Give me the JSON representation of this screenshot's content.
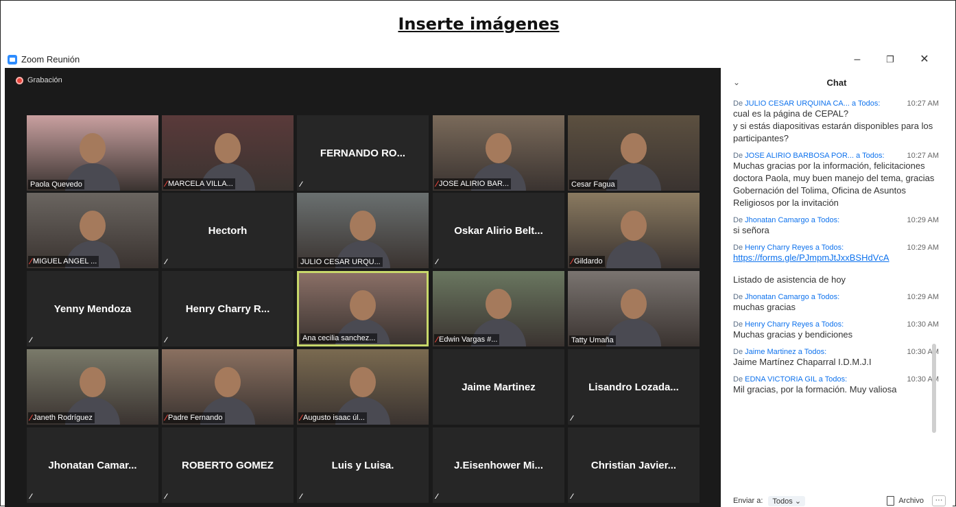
{
  "document": {
    "title": "Inserte imágenes"
  },
  "app": {
    "title": "Zoom Reunión",
    "minimize": "–",
    "restore": "❐",
    "close": "✕"
  },
  "recording": {
    "label": "Grabación"
  },
  "tiles": [
    {
      "label": "Paola Quevedo",
      "muted": false,
      "video": true,
      "bg": "#c9a0a0"
    },
    {
      "label": "MARCELA VILLA...",
      "muted": true,
      "video": true,
      "bg": "#5a3a3a"
    },
    {
      "label": "FERNANDO RO...",
      "muted": true,
      "video": false
    },
    {
      "label": "JOSE ALIRIO BAR...",
      "muted": true,
      "video": true,
      "bg": "#7a6a5a"
    },
    {
      "label": "Cesar Fagua",
      "muted": false,
      "video": true,
      "bg": "#5c5040"
    },
    {
      "label": "MIGUEL ANGEL ...",
      "muted": true,
      "video": true,
      "bg": "#6a6560"
    },
    {
      "label": "Hectorh",
      "muted": true,
      "video": false
    },
    {
      "label": "JULIO CESAR URQU...",
      "muted": false,
      "video": true,
      "bg": "#6a7070"
    },
    {
      "label": "Oskar Alirio Belt...",
      "muted": true,
      "video": false
    },
    {
      "label": "Gildardo",
      "muted": true,
      "video": true,
      "bg": "#8a7a60"
    },
    {
      "label": "Yenny Mendoza",
      "muted": true,
      "video": false
    },
    {
      "label": "Henry Charry R...",
      "muted": true,
      "video": false
    },
    {
      "label": "Ana cecilia sanchez...",
      "muted": false,
      "video": true,
      "active": true,
      "bg": "#8a6f66"
    },
    {
      "label": "Edwin Vargas #...",
      "muted": true,
      "video": true,
      "bg": "#6a7760"
    },
    {
      "label": "Tatty Umaña",
      "muted": false,
      "video": true,
      "bg": "#7a7470"
    },
    {
      "label": "Janeth Rodríguez",
      "muted": true,
      "video": true,
      "bg": "#7a7a6a"
    },
    {
      "label": "Padre Fernando",
      "muted": true,
      "video": true,
      "bg": "#8a7060"
    },
    {
      "label": "Augusto isaac úl...",
      "muted": true,
      "video": true,
      "bg": "#7a6a50"
    },
    {
      "label": "Jaime Martinez",
      "muted": false,
      "video": false
    },
    {
      "label": "Lisandro Lozada...",
      "muted": true,
      "video": false
    },
    {
      "label": "Jhonatan Camar...",
      "muted": true,
      "video": false
    },
    {
      "label": "ROBERTO GOMEZ",
      "muted": true,
      "video": false
    },
    {
      "label": "Luis y Luisa.",
      "muted": true,
      "video": false
    },
    {
      "label": "J.Eisenhower Mi...",
      "muted": true,
      "video": false
    },
    {
      "label": "Christian Javier...",
      "muted": true,
      "video": false
    }
  ],
  "chat": {
    "title": "Chat",
    "chevron": "⌄",
    "messages": [
      {
        "prefix": "De",
        "from": "JULIO CESAR URQUINA CA...",
        "to": "a Todos:",
        "time": "10:27 AM",
        "text": "cual es la página de CEPAL?\ny si estás diapositivas estarán disponibles para los participantes?"
      },
      {
        "prefix": "De",
        "from": "JOSE ALIRIO BARBOSA POR...",
        "to": "a Todos:",
        "time": "10:27 AM",
        "text": "Muchas gracias por la información, felicitaciones doctora Paola, muy buen manejo del tema, gracias Gobernación del Tolima, Oficina de Asuntos Religiosos por la invitación"
      },
      {
        "prefix": "De",
        "from": "Jhonatan Camargo",
        "to": "a Todos:",
        "time": "10:29 AM",
        "text": "si señora"
      },
      {
        "prefix": "De",
        "from": "Henry Charry Reyes",
        "to": "a Todos:",
        "time": "10:29 AM",
        "link": "https://forms.gle/PJmpmJtJxxBSHdVcA",
        "text": "Listado de asistencia de hoy"
      },
      {
        "prefix": "De",
        "from": "Jhonatan Camargo",
        "to": "a Todos:",
        "time": "10:29 AM",
        "text": "muchas gracias"
      },
      {
        "prefix": "De",
        "from": "Henry Charry Reyes",
        "to": "a Todos:",
        "time": "10:30 AM",
        "text": "Muchas gracias y bendiciones"
      },
      {
        "prefix": "De",
        "from": "Jaime Martinez",
        "to": "a Todos:",
        "time": "10:30 AM",
        "text": "Jaime Martínez  Chaparral  I.D.M.J.I"
      },
      {
        "prefix": "De",
        "from": "EDNA VICTORIA GIL",
        "to": "a Todos:",
        "time": "10:30 AM",
        "text": "Mil gracias, por la formación. Muy valiosa"
      }
    ],
    "send_to_label": "Enviar a:",
    "send_to_value": "Todos ⌄",
    "file_label": "Archivo",
    "more_label": "···"
  }
}
